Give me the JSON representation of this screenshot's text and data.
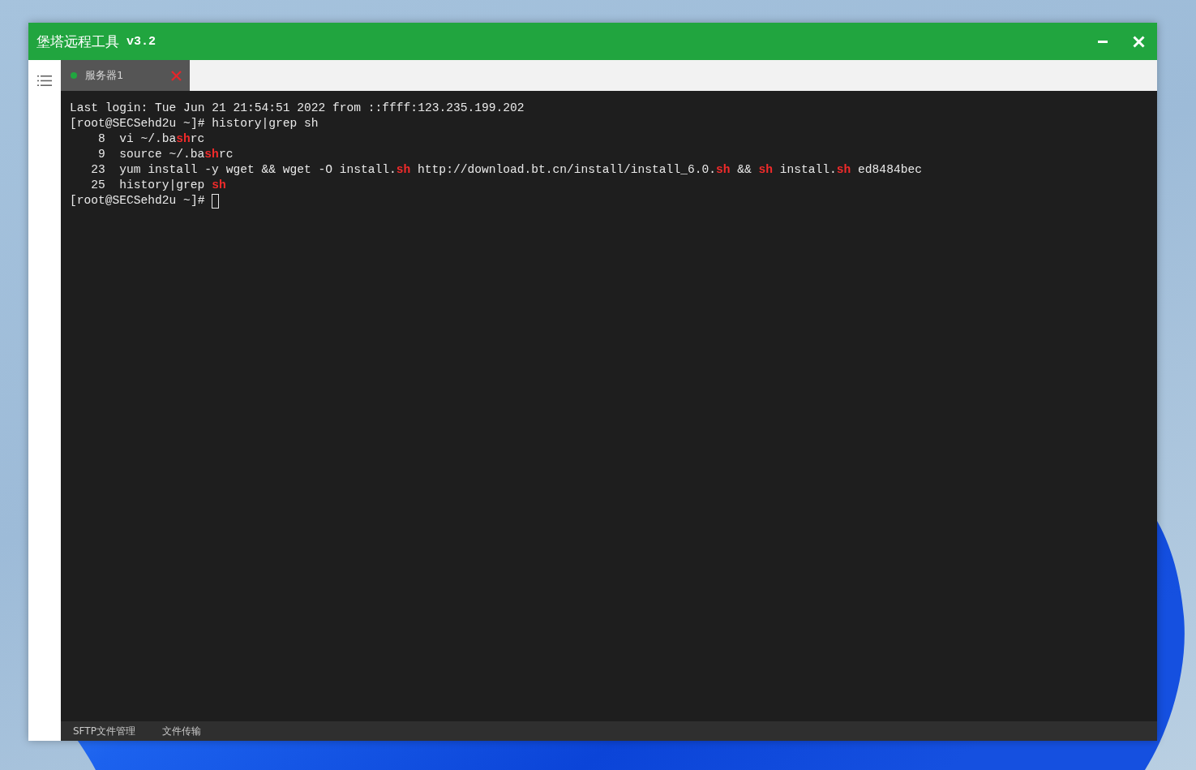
{
  "window": {
    "title": "堡塔远程工具",
    "version": "v3.2"
  },
  "tabs": [
    {
      "label": "服务器1",
      "selected": true,
      "connected": true
    }
  ],
  "terminal": {
    "lines": [
      {
        "segments": [
          {
            "text": "Last login: Tue Jun 21 21:54:51 2022 from ::ffff:123.235.199.202",
            "match": false
          }
        ],
        "cursor": false
      },
      {
        "segments": [
          {
            "text": "[root@SECSehd2u ~]# history|grep sh",
            "match": false
          }
        ],
        "cursor": false
      },
      {
        "number": "8",
        "segments": [
          {
            "text": "vi ~/.ba",
            "match": false
          },
          {
            "text": "sh",
            "match": true
          },
          {
            "text": "rc",
            "match": false
          }
        ],
        "cursor": false
      },
      {
        "number": "9",
        "segments": [
          {
            "text": "source ~/.ba",
            "match": false
          },
          {
            "text": "sh",
            "match": true
          },
          {
            "text": "rc",
            "match": false
          }
        ],
        "cursor": false
      },
      {
        "number": "23",
        "segments": [
          {
            "text": "yum install -y wget && wget -O install.",
            "match": false
          },
          {
            "text": "sh",
            "match": true
          },
          {
            "text": " http://download.bt.cn/install/install_6.0.",
            "match": false
          },
          {
            "text": "sh",
            "match": true
          },
          {
            "text": " && ",
            "match": false
          },
          {
            "text": "sh",
            "match": true
          },
          {
            "text": " install.",
            "match": false
          },
          {
            "text": "sh",
            "match": true
          },
          {
            "text": " ed8484bec",
            "match": false
          }
        ],
        "cursor": false
      },
      {
        "number": "25",
        "segments": [
          {
            "text": "history|grep ",
            "match": false
          },
          {
            "text": "sh",
            "match": true
          }
        ],
        "cursor": false
      },
      {
        "segments": [
          {
            "text": "[root@SECSehd2u ~]#",
            "match": false
          }
        ],
        "cursor": true
      }
    ]
  },
  "footer": {
    "items": [
      {
        "label": "SFTP文件管理"
      },
      {
        "label": "文件传输"
      }
    ]
  }
}
